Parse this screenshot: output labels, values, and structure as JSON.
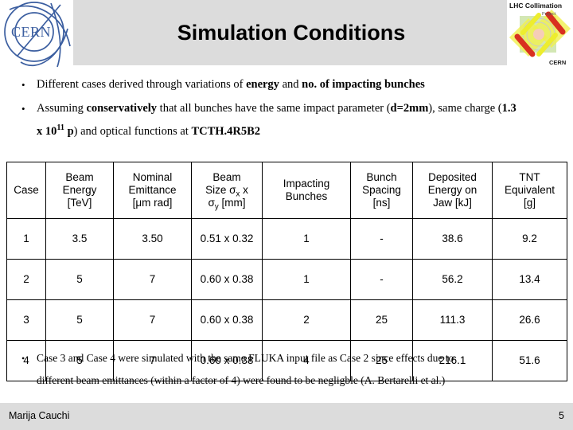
{
  "slide": {
    "title": "Simulation Conditions",
    "header_bg": "#dcdcdc",
    "footer_bg": "#dcdcdc"
  },
  "logos": {
    "left": {
      "name": "cern-logo",
      "text": "CERN",
      "color": "#3b5ea0"
    },
    "right": {
      "name": "lhc-collimation-project-logo",
      "line1": "LHC Collimation",
      "line2": "Project",
      "line3": "CERN",
      "colors": {
        "yellow": "#e8e81d",
        "red": "#d32020",
        "green": "#9bd14a"
      }
    }
  },
  "bullets": [
    {
      "marker": "•",
      "segments": [
        {
          "text": "Different cases derived through variations of ",
          "bold": false
        },
        {
          "text": "energy",
          "bold": true
        },
        {
          "text": " and ",
          "bold": false
        },
        {
          "text": "no. of impacting bunches",
          "bold": true
        }
      ]
    },
    {
      "marker": "•",
      "segments": [
        {
          "text": "Assuming ",
          "bold": false
        },
        {
          "text": "conservatively",
          "bold": true
        },
        {
          "text": " that all bunches have the same impact parameter (",
          "bold": false
        },
        {
          "text": "d=2mm",
          "bold": true
        },
        {
          "text": "), same charge (",
          "bold": false
        },
        {
          "text": "1.3",
          "bold": true
        }
      ],
      "line2": {
        "prefix_bold": "x 10",
        "superscript": "11",
        "mid_bold": " p",
        "rest": ") and optical functions at ",
        "tail_bold": "TCTH.4R5B2"
      }
    }
  ],
  "table": {
    "headers": [
      {
        "l1": "Case",
        "l2": "",
        "l3": ""
      },
      {
        "l1": "Beam",
        "l2": "Energy",
        "l3": "[TeV]"
      },
      {
        "l1": "Nominal",
        "l2": "Emittance",
        "l3": "[μm rad]"
      },
      {
        "l1": "Beam",
        "l2": "Size σx x",
        "l3": "σy [mm]"
      },
      {
        "l1": "Impacting",
        "l2": "Bunches",
        "l3": ""
      },
      {
        "l1": "Bunch",
        "l2": "Spacing",
        "l3": "[ns]"
      },
      {
        "l1": "Deposited",
        "l2": "Energy on",
        "l3": "Jaw [kJ]"
      },
      {
        "l1": "TNT",
        "l2": "Equivalent",
        "l3": "[g]"
      }
    ],
    "rows": [
      {
        "case": "1",
        "energy": "3.5",
        "emittance": "3.50",
        "size": "0.51 x 0.32",
        "bunches": "1",
        "spacing": "-",
        "deposited": "38.6",
        "tnt": "9.2"
      },
      {
        "case": "2",
        "energy": "5",
        "emittance": "7",
        "size": "0.60 x 0.38",
        "bunches": "1",
        "spacing": "-",
        "deposited": "56.2",
        "tnt": "13.4"
      },
      {
        "case": "3",
        "energy": "5",
        "emittance": "7",
        "size": "0.60 x 0.38",
        "bunches": "2",
        "spacing": "25",
        "deposited": "111.3",
        "tnt": "26.6"
      },
      {
        "case": "4",
        "energy": "5",
        "emittance": "7",
        "size": "0.60 x 0.38",
        "bunches": "4",
        "spacing": "25",
        "deposited": "216.1",
        "tnt": "51.6"
      }
    ]
  },
  "footnote": {
    "marker": "•",
    "line1": "Case 3 and Case 4 were simulated with the same FLUKA input file as Case 2 since effects due to",
    "line2": "different beam emittances (within a factor of 4) were found to be negligble (A. Bertarelli et al.)"
  },
  "footer": {
    "author": "Marija Cauchi",
    "page_number": "5"
  }
}
